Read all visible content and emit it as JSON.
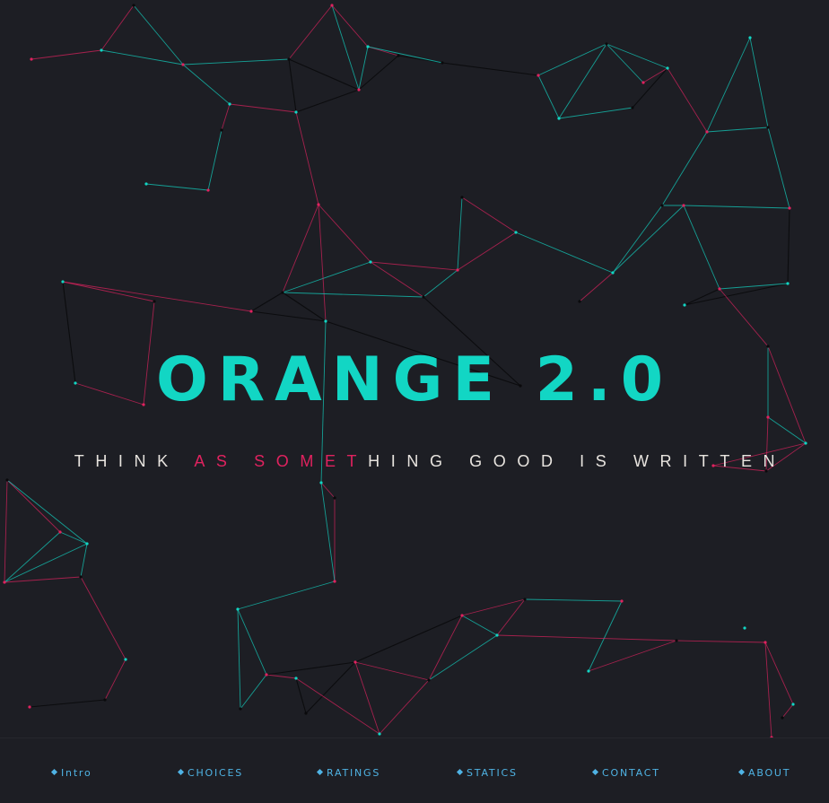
{
  "hero": {
    "title": "ORANGE 2.0",
    "tagline": "THINK AS SOMETHING GOOD IS WRITTEN",
    "tagline_colors": [
      "#e8e4df",
      "#e0225f",
      "#e8e4df"
    ]
  },
  "colors": {
    "background": "#1d1e24",
    "accent_teal": "#12d6c4",
    "accent_pink": "#e0225f",
    "nav_blue": "#4fb3e4"
  },
  "nav": {
    "items": [
      {
        "label": "Intro",
        "icon": "diamond-icon"
      },
      {
        "label": "CHOICES",
        "icon": "diamond-icon"
      },
      {
        "label": "RATINGS",
        "icon": "diamond-icon"
      },
      {
        "label": "STATICS",
        "icon": "diamond-icon"
      },
      {
        "label": "CONTACT",
        "icon": "diamond-icon"
      },
      {
        "label": "ABOUT",
        "icon": "diamond-icon"
      }
    ]
  }
}
